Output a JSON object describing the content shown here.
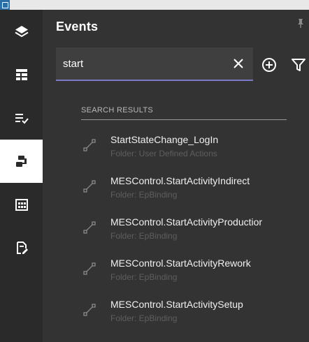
{
  "panel": {
    "title": "Events"
  },
  "search": {
    "value": "start",
    "placeholder": ""
  },
  "results": {
    "heading": "SEARCH RESULTS",
    "items": [
      {
        "name": "StartStateChange_LogIn",
        "folder": "Folder: User Defined Actions"
      },
      {
        "name": "MESControl.StartActivityIndirect",
        "folder": "Folder: EpBinding"
      },
      {
        "name": "MESControl.StartActivityProductior",
        "folder": "Folder: EpBinding"
      },
      {
        "name": "MESControl.StartActivityRework",
        "folder": "Folder: EpBinding"
      },
      {
        "name": "MESControl.StartActivitySetup",
        "folder": "Folder: EpBinding"
      }
    ]
  },
  "rail": {
    "items": [
      {
        "icon": "layers-icon",
        "active": false
      },
      {
        "icon": "table-layout-icon",
        "active": false
      },
      {
        "icon": "checklist-icon",
        "active": false
      },
      {
        "icon": "events-icon",
        "active": true
      },
      {
        "icon": "calendar-grid-icon",
        "active": false
      },
      {
        "icon": "document-edit-icon",
        "active": false
      }
    ]
  },
  "colors": {
    "rail_bg": "#2a2a2a",
    "panel_bg": "#333333",
    "search_bg": "#3f3f3f",
    "accent_underline": "#7b78c9",
    "active_rail": "#ffffff"
  }
}
